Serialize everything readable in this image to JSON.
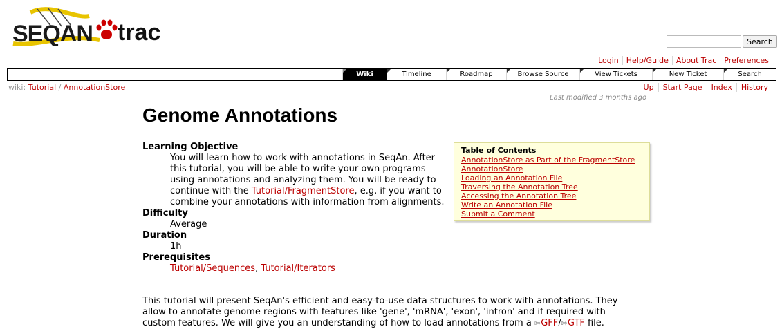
{
  "logo": {
    "seqan": "SEQAN",
    "trac": "trac"
  },
  "search": {
    "placeholder": "",
    "button": "Search"
  },
  "metanav": [
    "Login",
    "Help/Guide",
    "About Trac",
    "Preferences"
  ],
  "mainnav": [
    "Wiki",
    "Timeline",
    "Roadmap",
    "Browse Source",
    "View Tickets",
    "New Ticket",
    "Search"
  ],
  "breadcrumb": {
    "prefix": "wiki:",
    "parent": "Tutorial",
    "sep": "/",
    "current": "AnnotationStore"
  },
  "ctxtnav": [
    "Up",
    "Start Page",
    "Index",
    "History"
  ],
  "last_modified": "Last modified 3 months ago",
  "page": {
    "title": "Genome Annotations",
    "learning_objective_label": "Learning Objective",
    "learning_objective_pre": "You will learn how to work with annotations in SeqAn. After this tutorial, you will be able to write your own programs using annotations and analyzing them. You will be ready to continue with the ",
    "learning_objective_link": "Tutorial/FragmentStore",
    "learning_objective_post": ", e.g. if you want to combine your annotations with information from alignments.",
    "difficulty_label": "Difficulty",
    "difficulty": "Average",
    "duration_label": "Duration",
    "duration": "1h",
    "prerequisites_label": "Prerequisites",
    "prereq_1": "Tutorial/Sequences",
    "prereq_sep": ",",
    "prereq_2": "Tutorial/Iterators",
    "intro_pre": "This tutorial will present SeqAn's efficient and easy-to-use data structures to work with annotations. They allow to annotate genome regions with features like 'gene', 'mRNA', 'exon', 'intron' and if required with custom features. We will give you an understanding of how to load annotations from a ",
    "intro_gff": "GFF",
    "intro_slash": "/",
    "intro_gtf": "GTF",
    "intro_post": " file."
  },
  "toc": {
    "title": "Table of Contents",
    "items": [
      "AnnotationStore as Part of the FragmentStore",
      "AnnotationStore",
      "Loading an Annotation File",
      "Traversing the Annotation Tree",
      "Accessing the Annotation Tree",
      "Write an Annotation File",
      "Submit a Comment"
    ]
  },
  "colors": {
    "link": "#bb0000",
    "toc_bg": "#ffffdd",
    "nav_active": "#000000"
  }
}
